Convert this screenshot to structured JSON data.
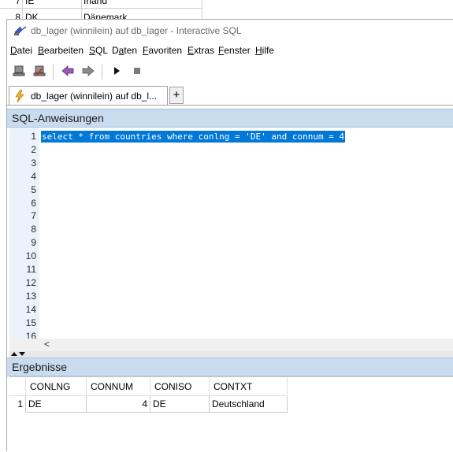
{
  "background_sheet": {
    "rows": [
      {
        "num": "7",
        "code": "IE",
        "name": "Irland"
      },
      {
        "num": "8",
        "code": "DK",
        "name": "Dänemark"
      }
    ]
  },
  "window": {
    "title": "db_lager (winnilein) auf db_lager - Interactive SQL"
  },
  "menu": [
    {
      "key": "D",
      "rest": "atei"
    },
    {
      "key": "B",
      "rest": "earbeiten"
    },
    {
      "key": "S",
      "rest": "QL"
    },
    {
      "key": "D",
      "rest": "aten",
      "suffix_first": true
    },
    {
      "key": "F",
      "rest": "avoriten"
    },
    {
      "key": "E",
      "rest": "xtras"
    },
    {
      "key": "F",
      "rest": "enster"
    },
    {
      "key": "H",
      "rest": "ilfe"
    }
  ],
  "menu_labels": [
    "Datei",
    "Bearbeiten",
    "SQL",
    "Daten",
    "Favoriten",
    "Extras",
    "Fenster",
    "Hilfe"
  ],
  "tab": {
    "label": "db_lager (winnilein) auf db_l...",
    "add_label": "+"
  },
  "sql_section": {
    "header": "SQL-Anweisungen",
    "line_numbers": [
      "1",
      "2",
      "3",
      "4",
      "5",
      "6",
      "7",
      "8",
      "9",
      "10",
      "11",
      "12",
      "13",
      "14",
      "15",
      "16"
    ],
    "statement": "select * from countries where conlng = 'DE' and connum = 4",
    "scroll_left": "<"
  },
  "results_section": {
    "header": "Ergebnisse",
    "columns": [
      "CONLNG",
      "CONNUM",
      "CONISO",
      "CONTXT"
    ],
    "rows": [
      {
        "rownum": "1",
        "conlng": "DE",
        "connum": "4",
        "coniso": "DE",
        "contxt": "Deutschland"
      }
    ]
  },
  "colors": {
    "section_header_bg": "#c9dbef",
    "selection": "#0078d7",
    "gutter": "#eaf2fb"
  },
  "icons": [
    "sql-window-icon",
    "connect-icon",
    "disconnect-icon",
    "back-arrow-icon",
    "forward-arrow-icon",
    "execute-icon",
    "stop-icon",
    "lightning-icon",
    "collapse-arrows-icon"
  ]
}
